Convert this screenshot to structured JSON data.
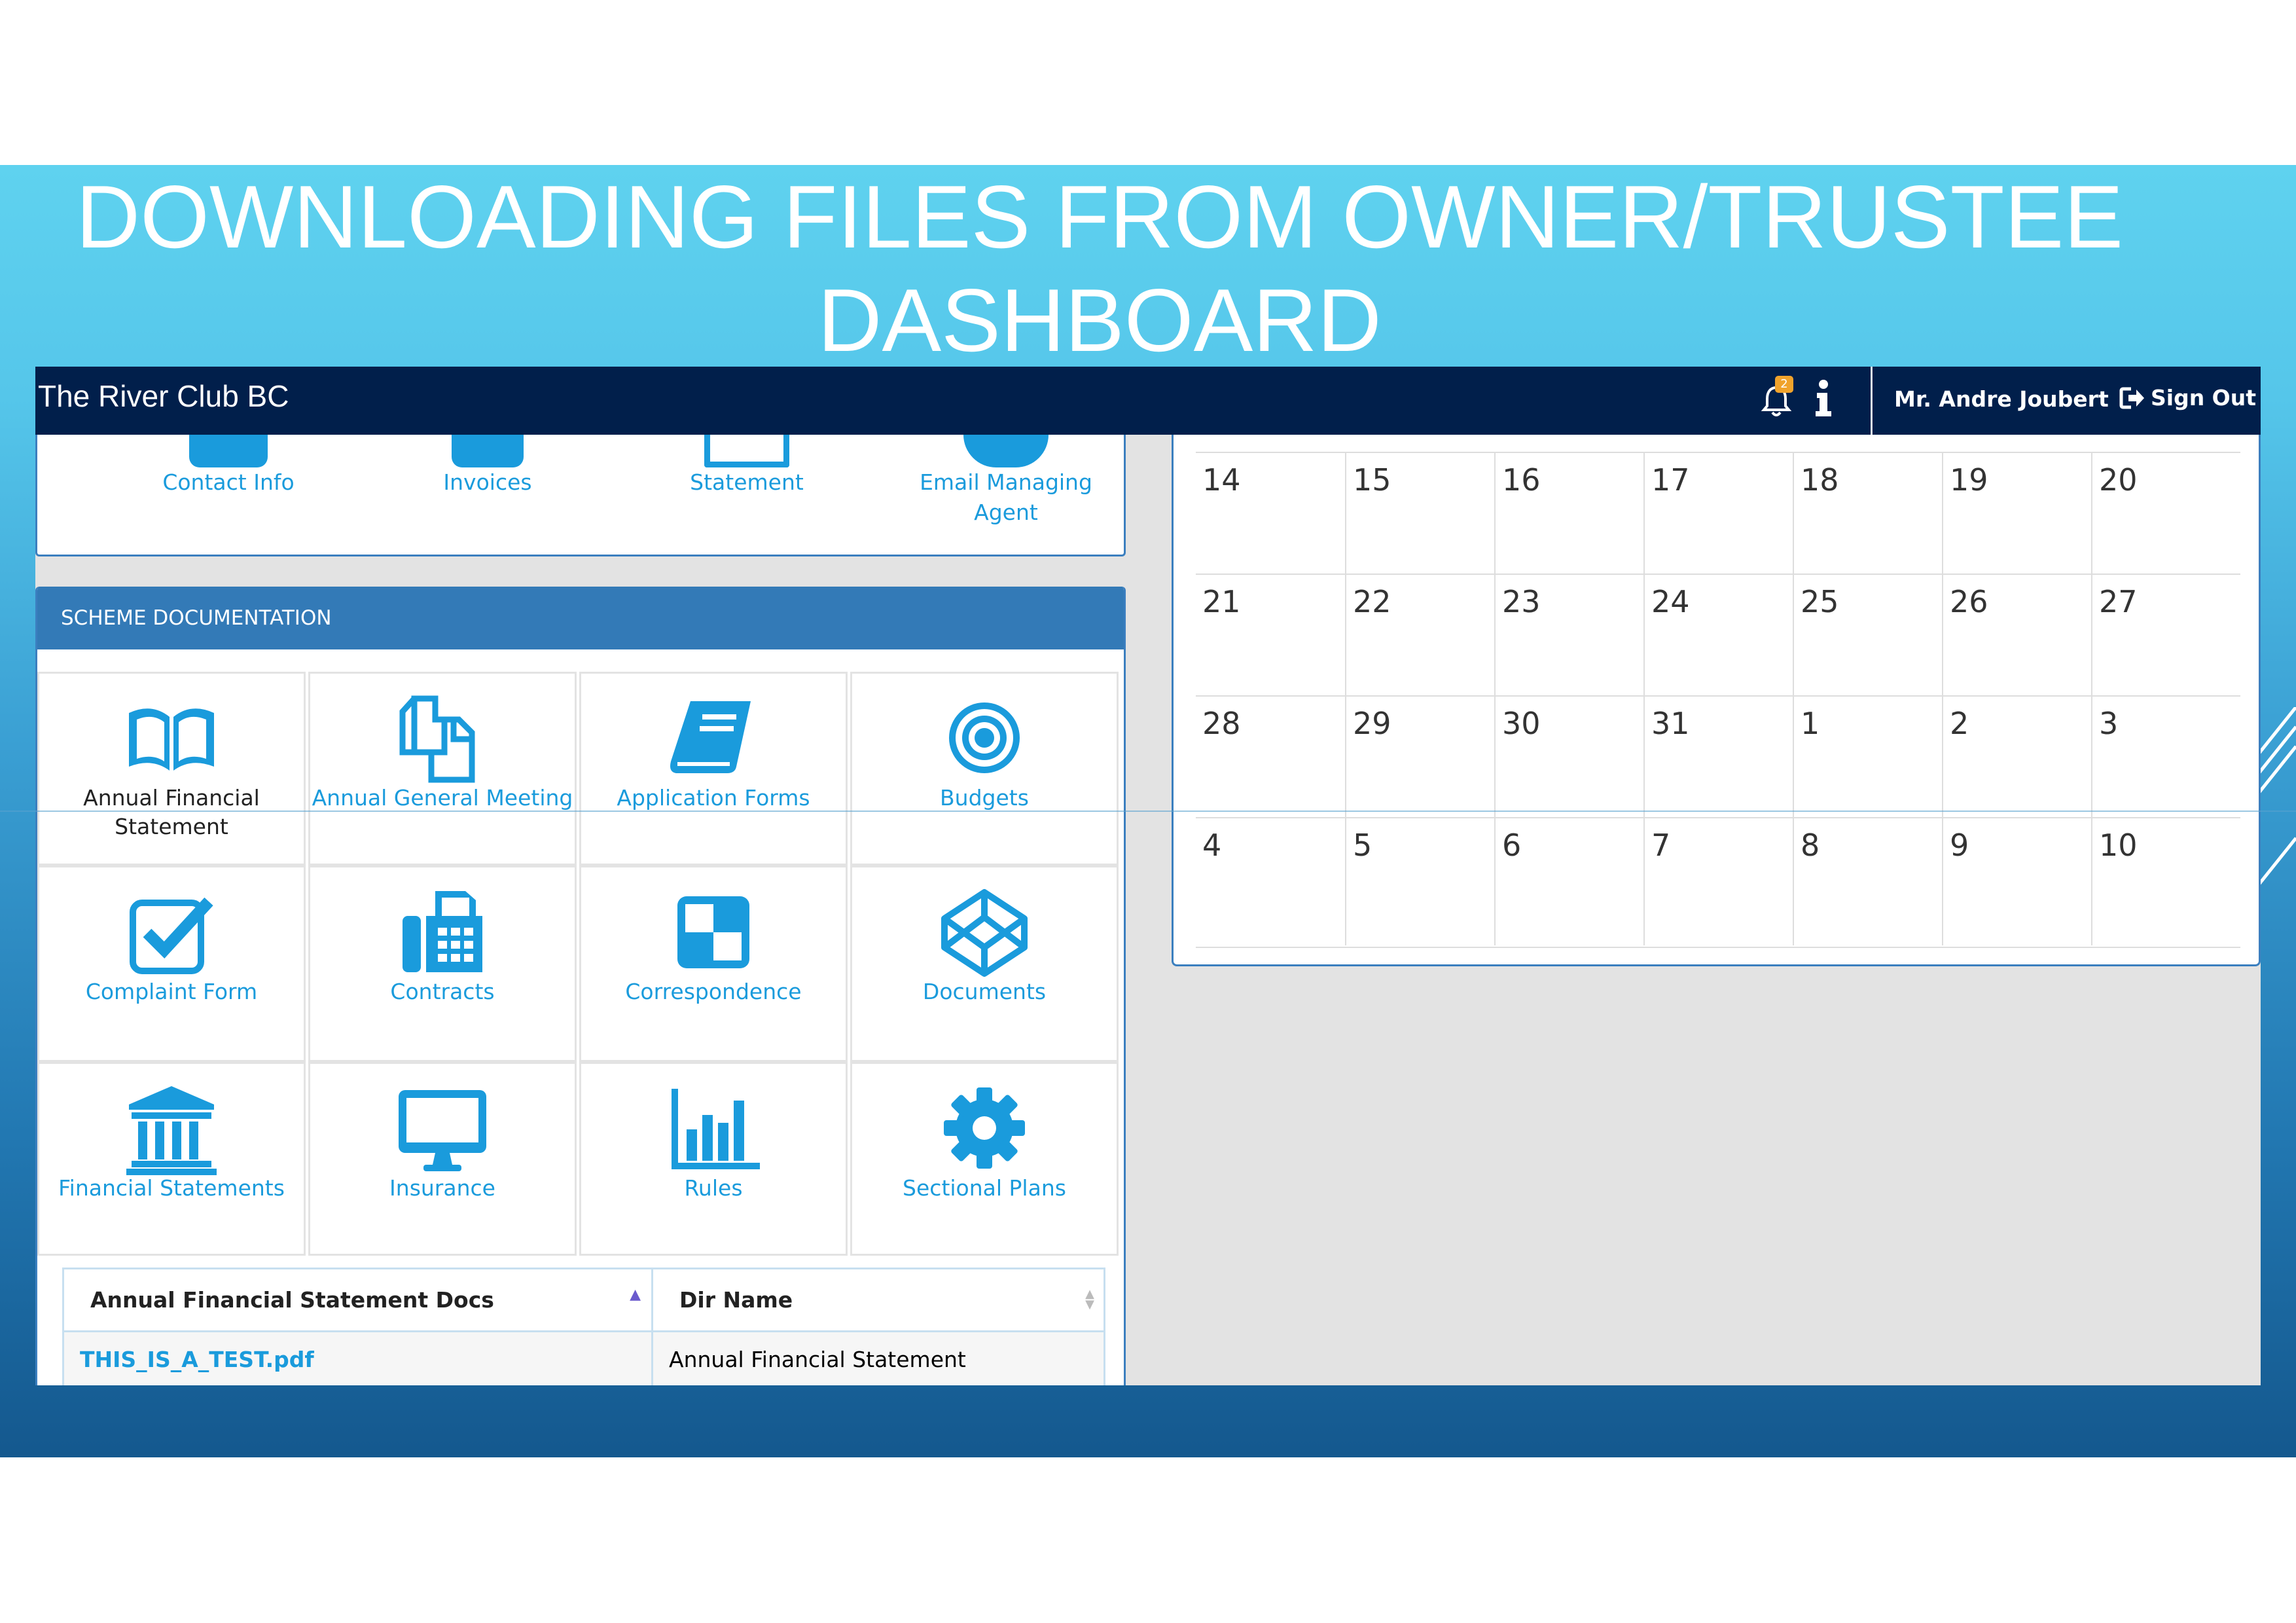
{
  "slide": {
    "title_line1": "DOWNLOADING FILES FROM OWNER/TRUSTEE",
    "title_line2": "DASHBOARD"
  },
  "topbar": {
    "brand": "The River Club BC",
    "notification_count": "2",
    "user_name": "Mr. Andre Joubert",
    "sign_out_label": "Sign Out"
  },
  "top_links": [
    {
      "label": "Contact Info",
      "icon": "user-icon"
    },
    {
      "label": "Invoices",
      "icon": "invoice-icon"
    },
    {
      "label": "Statement",
      "icon": "statement-icon"
    },
    {
      "label": "Email Managing Agent",
      "icon": "email-icon"
    }
  ],
  "scheme": {
    "header": "SCHEME DOCUMENTATION",
    "tiles": [
      {
        "label": "Annual Financial Statement",
        "icon": "open-book-icon",
        "active": true
      },
      {
        "label": "Annual General Meeting",
        "icon": "copy-files-icon"
      },
      {
        "label": "Application Forms",
        "icon": "book-icon"
      },
      {
        "label": "Budgets",
        "icon": "target-icon"
      },
      {
        "label": "Complaint Form",
        "icon": "checkbox-icon"
      },
      {
        "label": "Contracts",
        "icon": "fax-icon"
      },
      {
        "label": "Correspondence",
        "icon": "checker-icon"
      },
      {
        "label": "Documents",
        "icon": "codepen-icon"
      },
      {
        "label": "Financial Statements",
        "icon": "bank-icon"
      },
      {
        "label": "Insurance",
        "icon": "monitor-icon"
      },
      {
        "label": "Rules",
        "icon": "bar-chart-icon"
      },
      {
        "label": "Sectional Plans",
        "icon": "gear-icon"
      }
    ],
    "table": {
      "headers": [
        "Annual Financial Statement Docs",
        "Dir Name"
      ],
      "rows": [
        {
          "file": "THIS_IS_A_TEST.pdf",
          "dir": "Annual Financial Statement"
        }
      ]
    }
  },
  "calendar": {
    "weeks": [
      [
        "14",
        "15",
        "16",
        "17",
        "18",
        "19",
        "20"
      ],
      [
        "21",
        "22",
        "23",
        "24",
        "25",
        "26",
        "27"
      ],
      [
        "28",
        "29",
        "30",
        "31",
        "1",
        "2",
        "3"
      ],
      [
        "4",
        "5",
        "6",
        "7",
        "8",
        "9",
        "10"
      ]
    ]
  },
  "colors": {
    "navbar": "#011f4b",
    "panel_header": "#337ab7",
    "icon_blue": "#1a9bdc",
    "badge": "#f0a32c"
  }
}
